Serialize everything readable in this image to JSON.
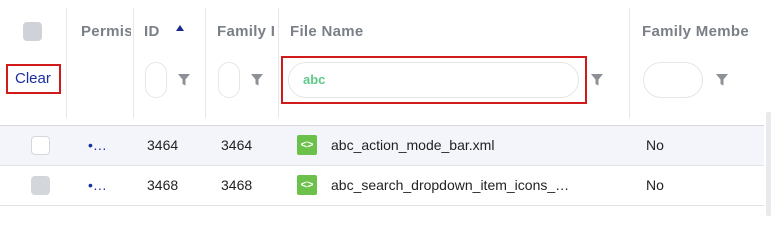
{
  "columns": {
    "permissions": "Permis",
    "id": "ID",
    "family": "Family I",
    "file_name": "File Name",
    "family_member": "Family Membe"
  },
  "clear_label": "Clear",
  "filters": {
    "file_name_value": "abc"
  },
  "rows": [
    {
      "permissions": "•…",
      "id": "3464",
      "family": "3464",
      "file_icon": "<>",
      "file_name": "abc_action_mode_bar.xml",
      "family_member": "No"
    },
    {
      "permissions": "•…",
      "id": "3468",
      "family": "3468",
      "file_icon": "<>",
      "file_name": "abc_search_dropdown_item_icons_…",
      "family_member": "No"
    }
  ],
  "colors": {
    "accent": "#1a2fa0",
    "highlight": "#d11a1a",
    "file_icon": "#6cc14b"
  }
}
